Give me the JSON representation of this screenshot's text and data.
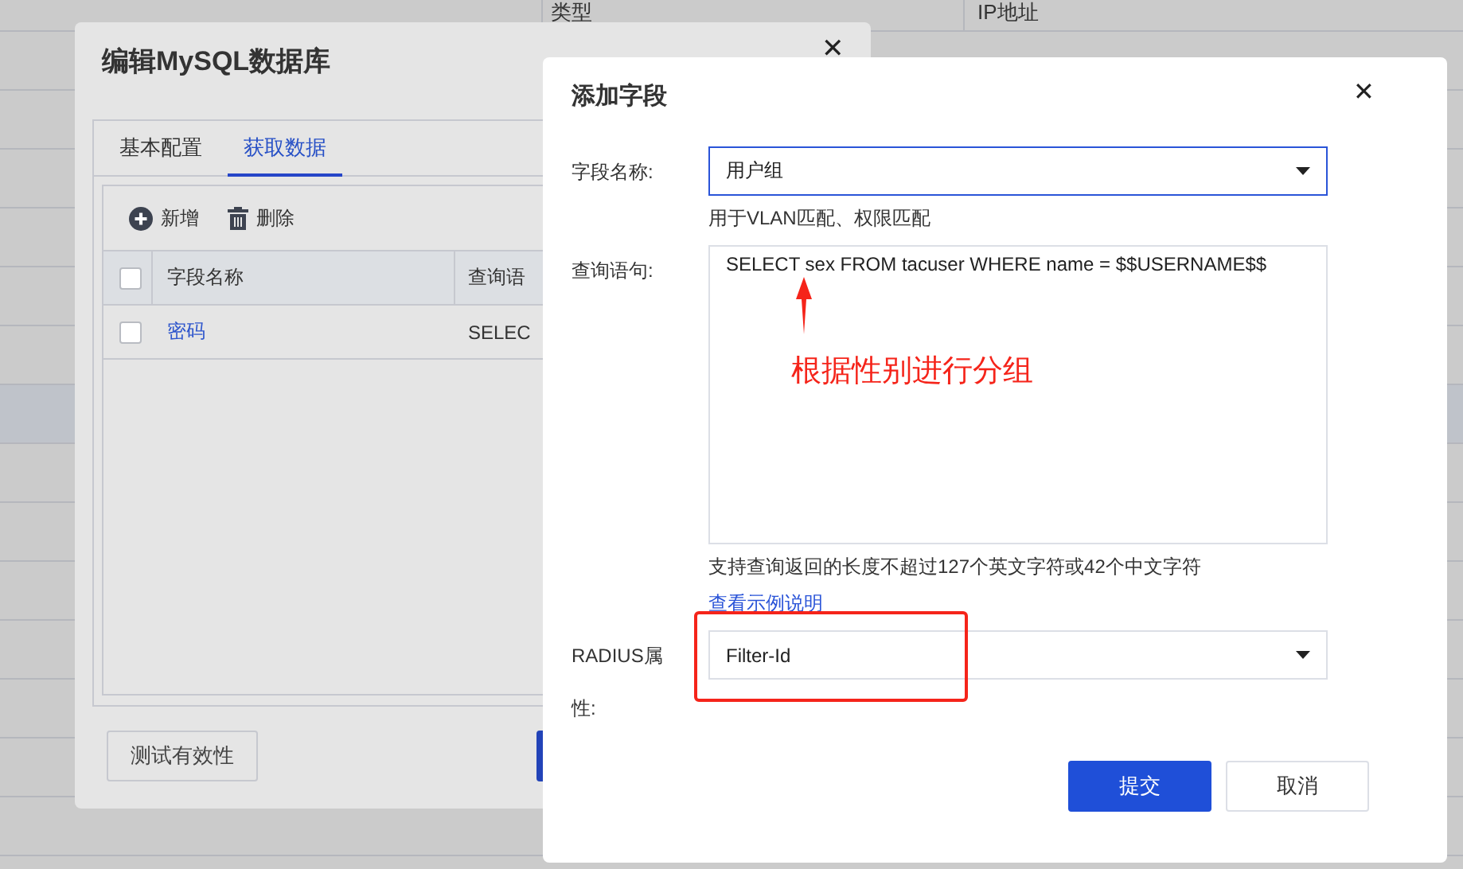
{
  "background_table": {
    "columns": [
      "类型",
      "IP地址"
    ]
  },
  "edit_dialog": {
    "title": "编辑MySQL数据库",
    "close": "✕",
    "tabs": [
      {
        "label": "基本配置",
        "selected": false
      },
      {
        "label": "获取数据",
        "selected": true
      }
    ],
    "toolbar": [
      {
        "kind": "add",
        "label": "新增"
      },
      {
        "kind": "delete",
        "label": "删除"
      }
    ],
    "table": {
      "columns": [
        "字段名称",
        "查询语"
      ],
      "header_checked": false,
      "rows": [
        {
          "checked": false,
          "cells": [
            "密码",
            "SELEC"
          ]
        }
      ]
    },
    "buttons": [
      {
        "kind": "default",
        "label": "测试有效性"
      },
      {
        "kind": "primary"
      }
    ]
  },
  "add_field_dialog": {
    "title": "添加字段",
    "close": "✕",
    "fields": [
      {
        "kind": "select",
        "label": "字段名称:",
        "value": "用户组",
        "focused": true,
        "hint": "用于VLAN匹配、权限匹配"
      },
      {
        "kind": "textarea",
        "label": "查询语句:",
        "value": "SELECT sex FROM tacuser WHERE name = $$USERNAME$$",
        "hint": "支持查询返回的长度不超过127个英文字符或42个中文字符",
        "link": "查看示例说明",
        "annotation": "根据性别进行分组"
      },
      {
        "kind": "select",
        "label": "RADIUS属性:",
        "value": "Filter-Id",
        "focused": false,
        "highlighted": true
      }
    ],
    "buttons": [
      {
        "kind": "primary",
        "label": "提交"
      },
      {
        "kind": "default",
        "label": "取消"
      }
    ]
  }
}
